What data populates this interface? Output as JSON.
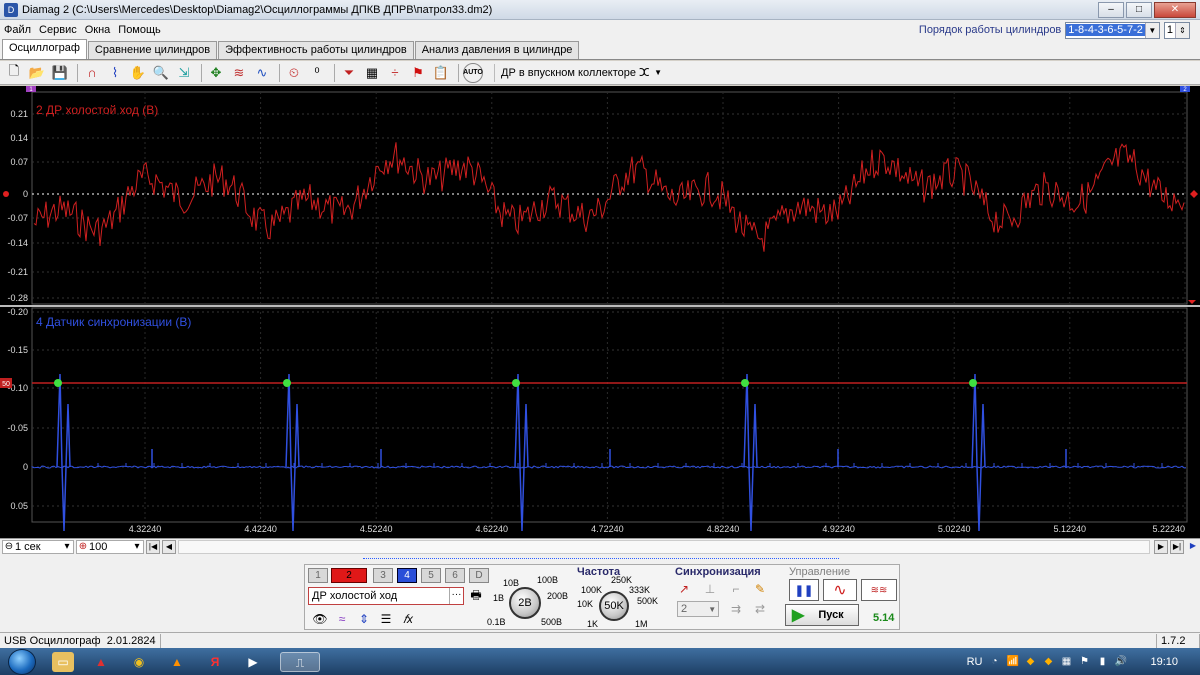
{
  "window": {
    "title": "Diamag 2 (C:\\Users\\Mercedes\\Desktop\\Diamag2\\Осциллограммы ДПКВ ДПРВ\\патрол33.dm2)",
    "controls": [
      "–",
      "□",
      "✕"
    ]
  },
  "menu": {
    "items": [
      "Файл",
      "Сервис",
      "Окна",
      "Помощь"
    ],
    "firing_order_label": "Порядок работы цилиндров",
    "firing_order_value": "1-8-4-3-6-5-7-2",
    "cylinder_value": "1"
  },
  "tabs": [
    "Осциллограф",
    "Сравнение цилиндров",
    "Эффективность работы цилиндров",
    "Анализ давления в цилиндре"
  ],
  "toolbar": {
    "channel_label": "ДР в впускном коллекторе",
    "auto_label": "AUTO"
  },
  "scope": {
    "top": {
      "label": "2 ДР холостой ход (В)",
      "ticks": [
        "0.21",
        "0.14",
        "0.07",
        "0",
        "-0.07",
        "-0.14",
        "-0.21",
        "-0.28"
      ],
      "color": "#d02020",
      "marker_left": "1",
      "marker_right": "2"
    },
    "bottom": {
      "label": "4 Датчик синхронизации (В)",
      "ticks": [
        "-0.20",
        "-0.15",
        "-0.10",
        "-0.05",
        "0",
        "0.05"
      ],
      "color": "#3050e0",
      "trigger_label": "50"
    },
    "time_ticks": [
      "4.32240",
      "4.42240",
      "4.52240",
      "4.62240",
      "4.72240",
      "4.82240",
      "4.92240",
      "5.02240",
      "5.12240",
      "5.22240"
    ]
  },
  "nav": {
    "timebase": "1 сек",
    "zoom": "100"
  },
  "panel": {
    "channels": [
      "1",
      "2",
      "3",
      "4",
      "5",
      "6",
      "D"
    ],
    "channel_name": "ДР холостой ход",
    "volt_labels": [
      "10В",
      "100В",
      "1В",
      "200В",
      "0.1В",
      "500В"
    ],
    "volt_value": "2В",
    "freq_title": "Частота",
    "freq_labels": [
      "250K",
      "100K",
      "333K",
      "500K",
      "10K",
      "1K",
      "1M"
    ],
    "freq_value": "50K",
    "sync_title": "Синхронизация",
    "sync_value": "2",
    "control_title": "Управление",
    "start_label": "Пуск",
    "speed_value": "5.14"
  },
  "status": {
    "device": "USB Осциллограф",
    "date": "2.01.2824",
    "version": "1.7.2"
  },
  "taskbar": {
    "lang": "RU",
    "time": "19:10"
  }
}
